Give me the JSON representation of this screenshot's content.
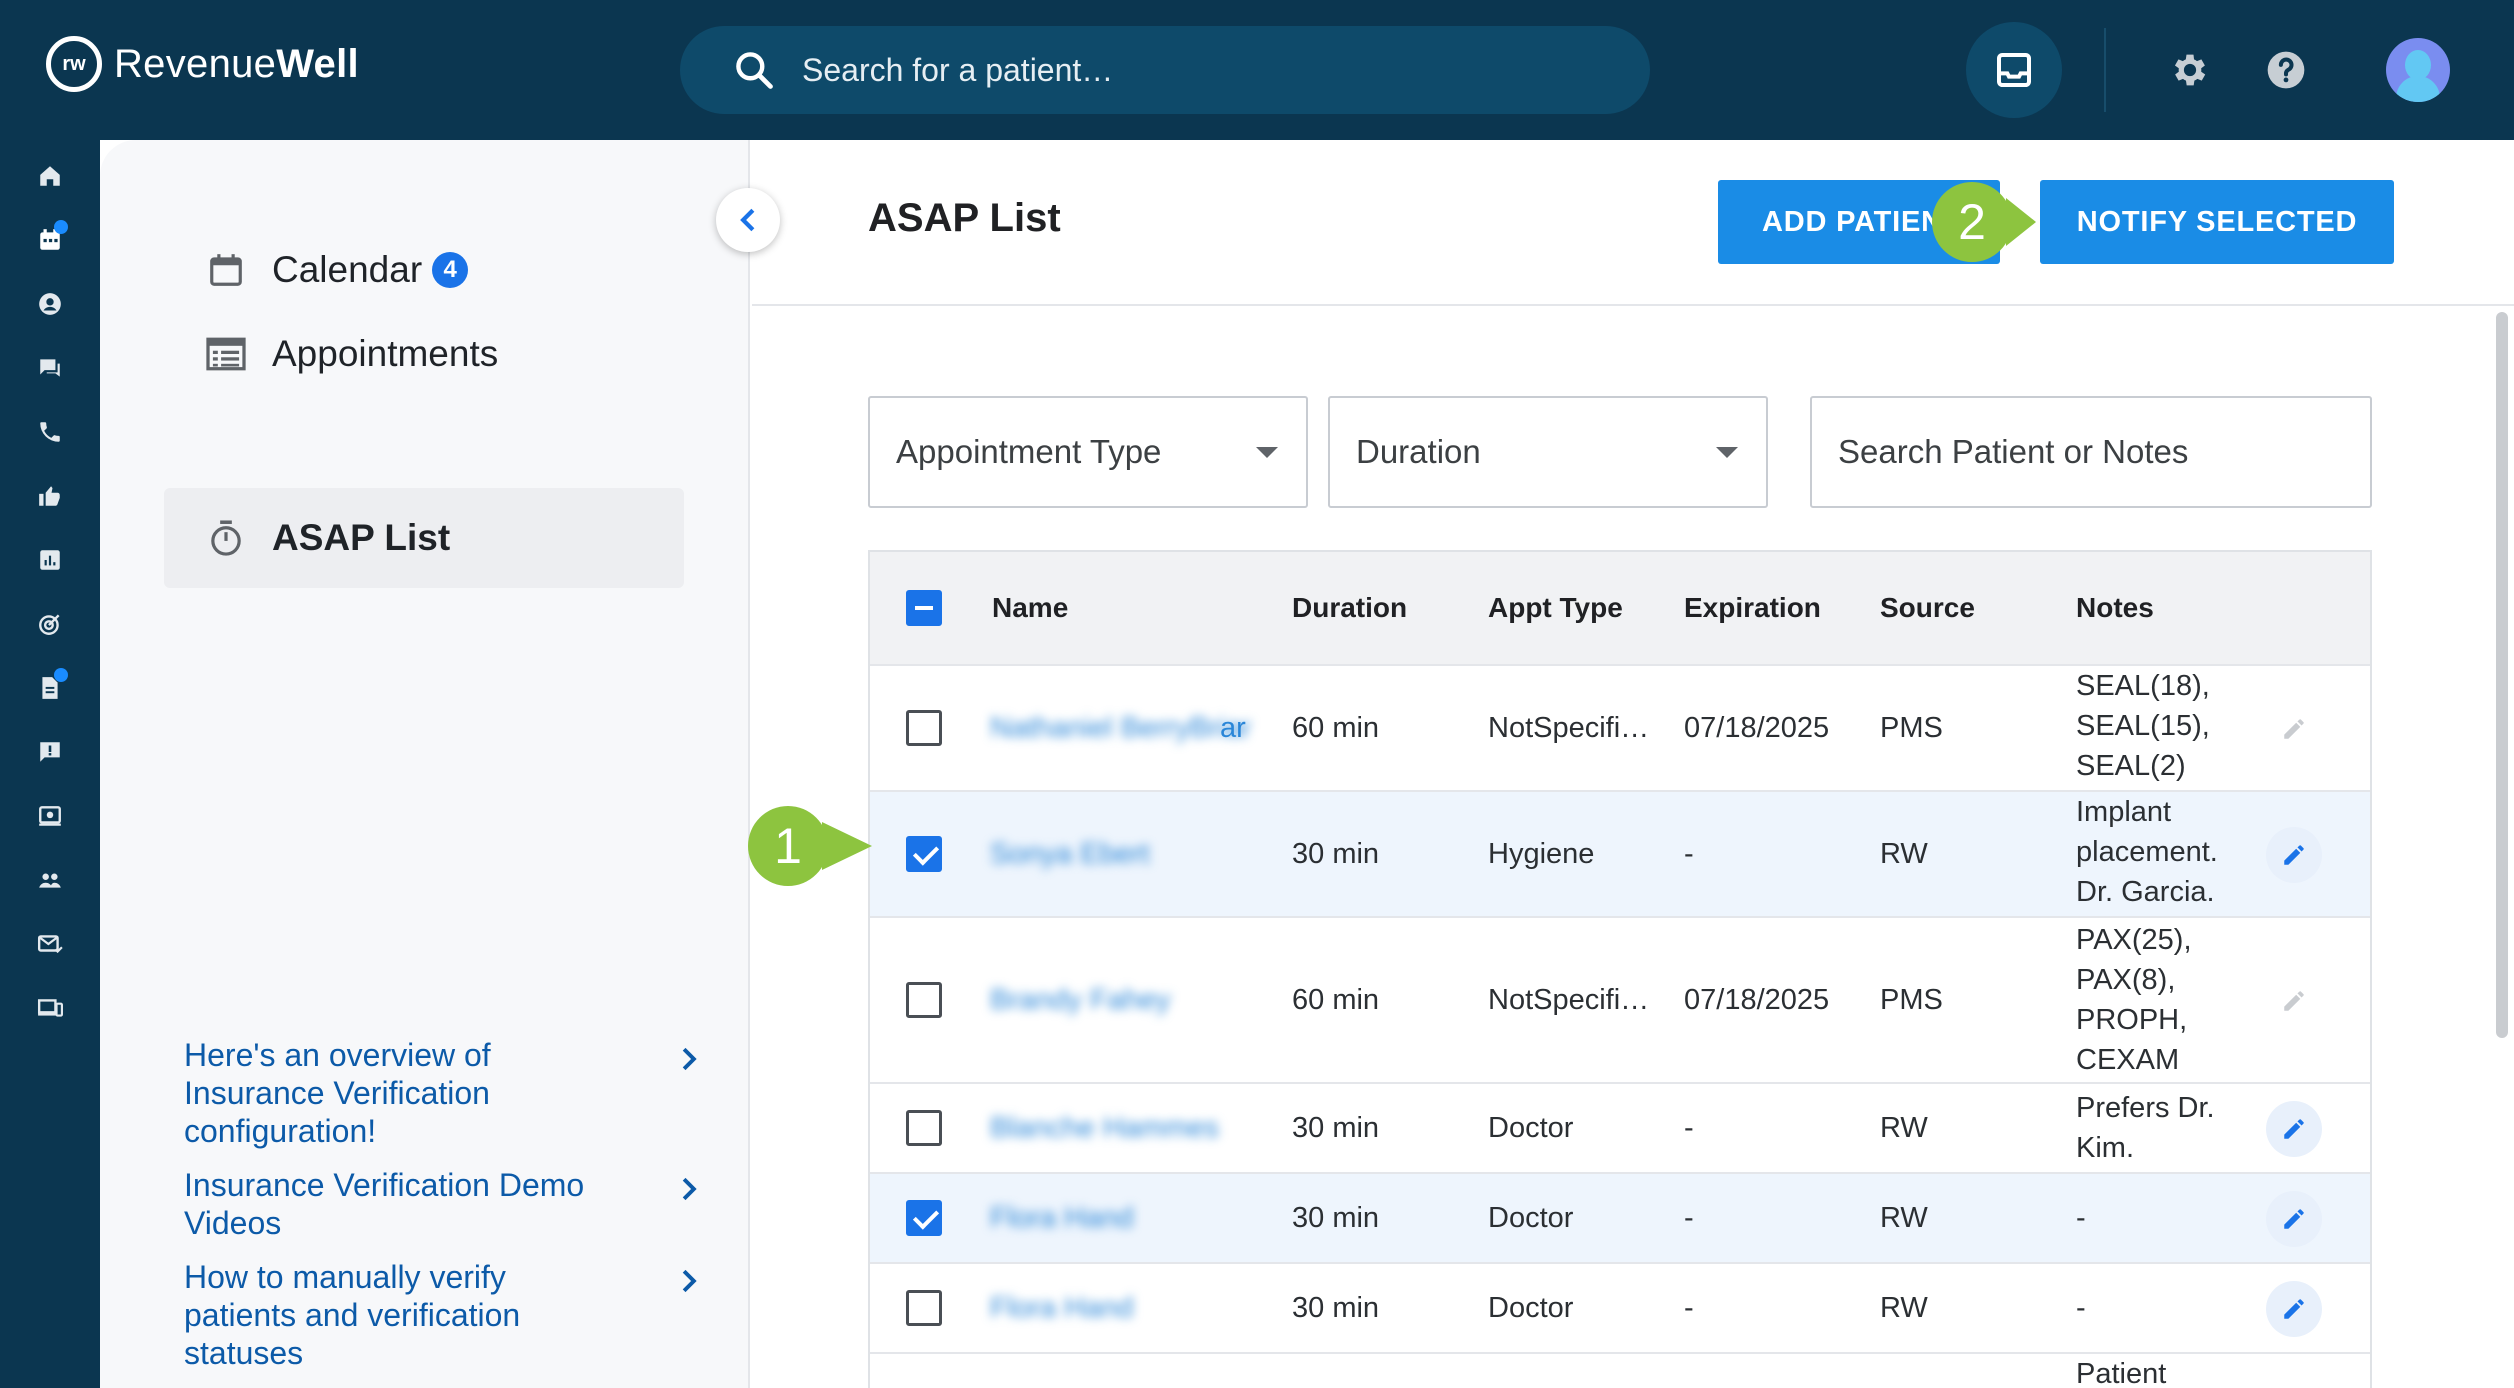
{
  "app": {
    "logo_mark": "rw",
    "logo_text_regular": "Revenue",
    "logo_text_bold": "Well"
  },
  "search": {
    "placeholder": "Search for a patient…"
  },
  "sidebar": {
    "items": [
      {
        "label": "Calendar",
        "badge": "4",
        "icon": "calendar-icon"
      },
      {
        "label": "Appointments",
        "icon": "list-icon"
      },
      {
        "label": "ASAP List",
        "icon": "timer-icon",
        "active": true
      }
    ],
    "help_links": [
      {
        "text": "Here's an overview of Insurance Verification configuration!"
      },
      {
        "text": "Insurance Verification Demo Videos"
      },
      {
        "text": "How to manually verify patients and verification statuses"
      }
    ]
  },
  "page": {
    "title": "ASAP List",
    "add_patient_label": "ADD PATIENT",
    "notify_selected_label": "NOTIFY SELECTED"
  },
  "callouts": {
    "one": "1",
    "two": "2"
  },
  "filters": {
    "appointment_type": "Appointment Type",
    "duration": "Duration",
    "search_placeholder": "Search Patient or Notes"
  },
  "table": {
    "columns": [
      "Name",
      "Duration",
      "Appt Type",
      "Expiration",
      "Source",
      "Notes"
    ],
    "rows": [
      {
        "name": "Nathaniel BerryBriar",
        "name_visible_tail": "ar",
        "duration": "60 min",
        "appt_type": "NotSpecifi…",
        "expiration": "07/18/2025",
        "source": "PMS",
        "notes": [
          "SEAL(18),",
          "SEAL(15),",
          "SEAL(2)"
        ],
        "checked": false,
        "editable": false
      },
      {
        "name": "Sonya Ebert",
        "duration": "30 min",
        "appt_type": "Hygiene",
        "expiration": "-",
        "source": "RW",
        "notes": [
          "Implant",
          "placement.",
          "Dr. Garcia."
        ],
        "checked": true,
        "editable": true
      },
      {
        "name": "Brandy Fahey",
        "duration": "60 min",
        "appt_type": "NotSpecifi…",
        "expiration": "07/18/2025",
        "source": "PMS",
        "notes": [
          "PAX(25),",
          "PAX(8),",
          "PROPH,",
          "CEXAM"
        ],
        "checked": false,
        "editable": false
      },
      {
        "name": "Blanche Hammes",
        "duration": "30 min",
        "appt_type": "Doctor",
        "expiration": "-",
        "source": "RW",
        "notes": [
          "Prefers Dr.",
          "Kim."
        ],
        "checked": false,
        "editable": true
      },
      {
        "name": "Flora Hand",
        "duration": "30 min",
        "appt_type": "Doctor",
        "expiration": "-",
        "source": "RW",
        "notes": [
          "-"
        ],
        "checked": true,
        "editable": true
      },
      {
        "name": "Flora Hand",
        "duration": "30 min",
        "appt_type": "Doctor",
        "expiration": "-",
        "source": "RW",
        "notes": [
          "-"
        ],
        "checked": false,
        "editable": true
      },
      {
        "name": "",
        "duration": "",
        "appt_type": "",
        "expiration": "",
        "source": "",
        "notes": [
          "Patient"
        ],
        "checked": false,
        "editable": false
      }
    ]
  },
  "colors": {
    "topbar": "#0b3650",
    "accent": "#1a8ce6",
    "callout": "#8dc43f",
    "link": "#0c5aa8"
  }
}
